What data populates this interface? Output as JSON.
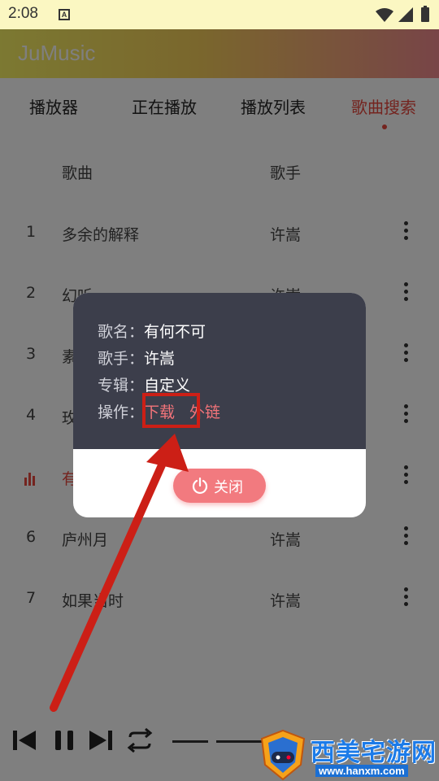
{
  "status": {
    "time": "2:08",
    "notif_letter": "A"
  },
  "app": {
    "title": "JuMusic"
  },
  "tabs": [
    {
      "label": "播放器",
      "active": false
    },
    {
      "label": "正在播放",
      "active": false
    },
    {
      "label": "播放列表",
      "active": false
    },
    {
      "label": "歌曲搜索",
      "active": true
    }
  ],
  "list": {
    "header": {
      "song": "歌曲",
      "artist": "歌手"
    },
    "rows": [
      {
        "num": "1",
        "song": "多余的解释",
        "artist": "许嵩"
      },
      {
        "num": "2",
        "song": "幻听",
        "artist": "许嵩"
      },
      {
        "num": "3",
        "song": "素",
        "artist": ""
      },
      {
        "num": "4",
        "song": "玫",
        "artist": ""
      },
      {
        "num": "",
        "song": "有",
        "artist": "",
        "playing": true
      },
      {
        "num": "6",
        "song": "庐州月",
        "artist": "许嵩"
      },
      {
        "num": "7",
        "song": "如果当时",
        "artist": "许嵩"
      }
    ]
  },
  "dialog": {
    "song_label": "歌名：",
    "song_value": "有何不可",
    "artist_label": "歌手：",
    "artist_value": "许嵩",
    "album_label": "专辑：",
    "album_value": "自定义",
    "action_label": "操作：",
    "download": "下载",
    "external_link": "外链",
    "close_label": "关闭"
  },
  "watermark": {
    "text": "西美宅游网",
    "sub": "www.hanxm.com"
  },
  "colors": {
    "accent": "#e8483f",
    "dialog_bg": "#3c3e4b",
    "link": "#f4747a",
    "button": "#f27a7f",
    "highlight": "#cc1f16"
  }
}
